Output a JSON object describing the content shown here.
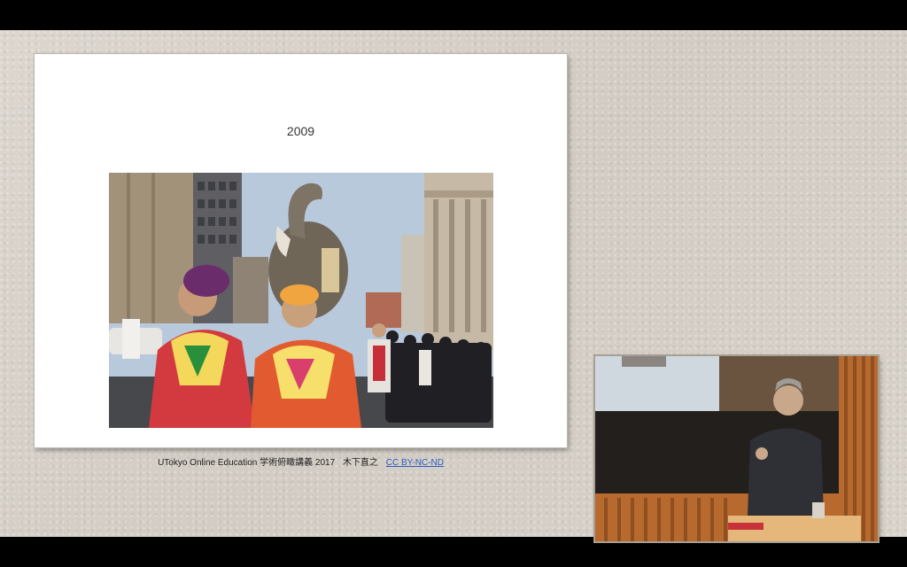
{
  "slide": {
    "title": "2009",
    "credit": {
      "text": "UTokyo Online Education 学術俯瞰講義 2017",
      "author": "木下直之",
      "license_link": "CC BY-NC-ND"
    },
    "photo_description_icon": "parade-photo"
  },
  "video": {
    "icon": "lecturer-video"
  },
  "colors": {
    "frame": "#000000",
    "background": "#d8d2ca",
    "slide": "#ffffff",
    "link": "#2a5bbf"
  }
}
